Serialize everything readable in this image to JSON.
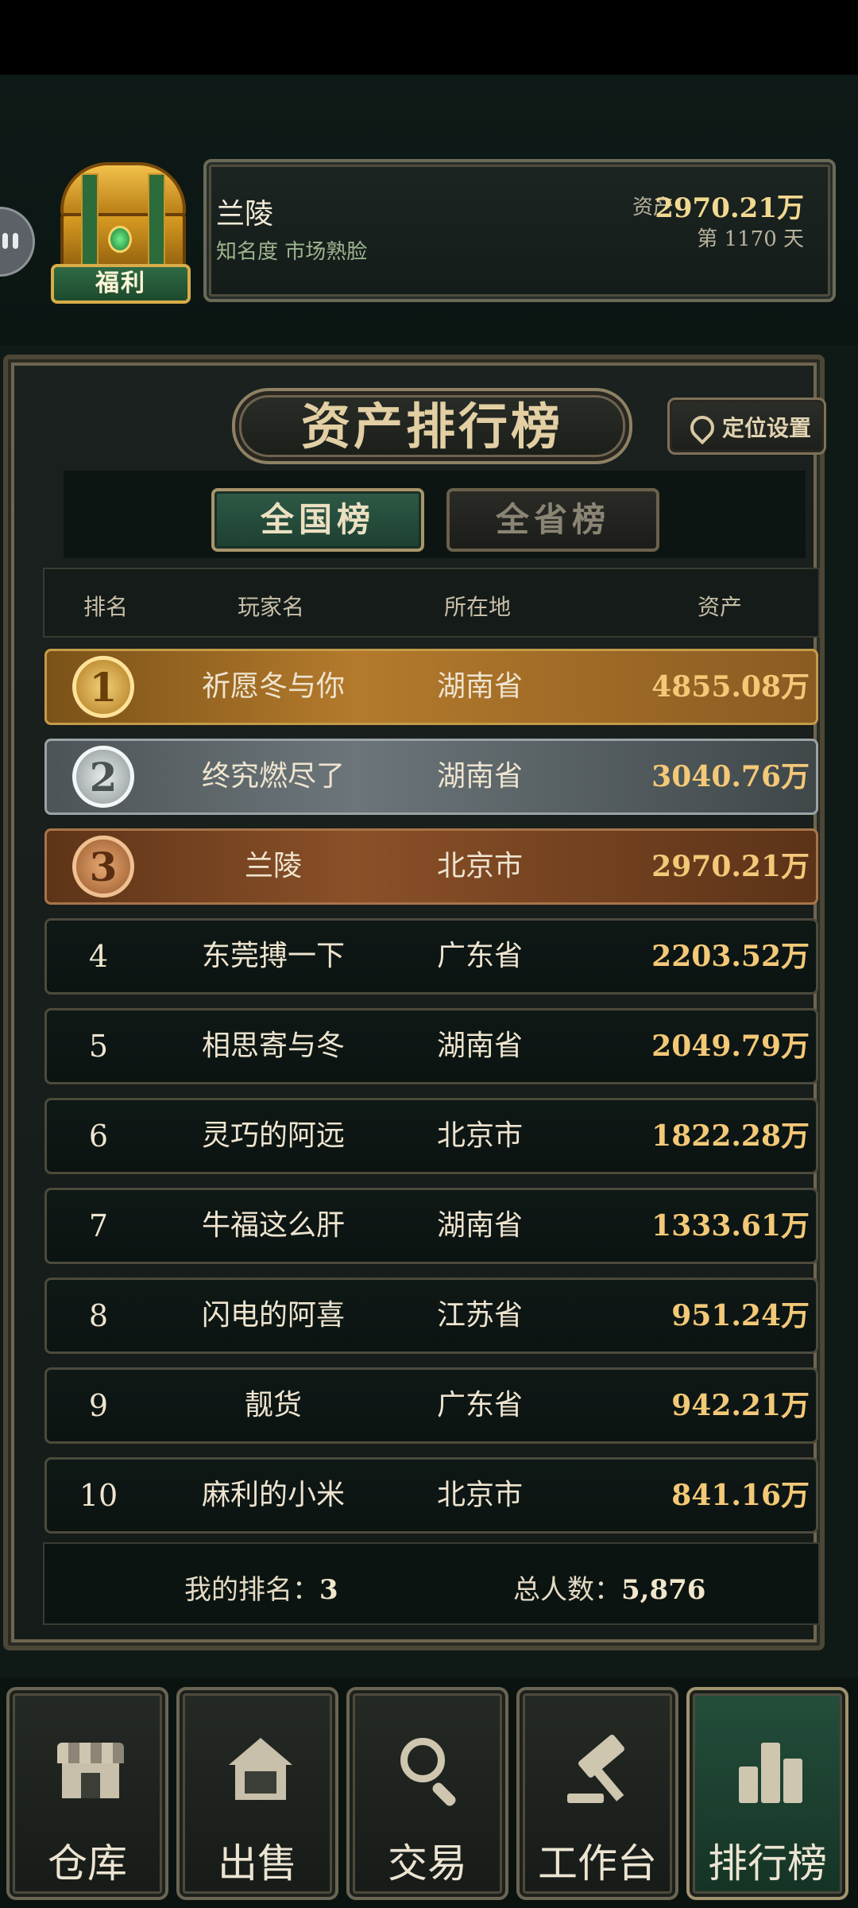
{
  "player": {
    "name": "兰陵",
    "fame": "知名度 市场熟脸",
    "asset_label": "资产",
    "asset_value": "2970.21万",
    "day": "第 1170 天"
  },
  "welfare_label": "福利",
  "panel": {
    "title": "资产排行榜",
    "location_button": "定位设置",
    "tabs": [
      {
        "label": "全国榜",
        "active": true
      },
      {
        "label": "全省榜",
        "active": false
      }
    ],
    "columns": [
      "排名",
      "玩家名",
      "所在地",
      "资产"
    ]
  },
  "rankings": [
    {
      "rank": "1",
      "name": "祈愿冬与你",
      "location": "湖南省",
      "assets": "4855.08万"
    },
    {
      "rank": "2",
      "name": "终究燃尽了",
      "location": "湖南省",
      "assets": "3040.76万"
    },
    {
      "rank": "3",
      "name": "兰陵",
      "location": "北京市",
      "assets": "2970.21万"
    },
    {
      "rank": "4",
      "name": "东莞搏一下",
      "location": "广东省",
      "assets": "2203.52万"
    },
    {
      "rank": "5",
      "name": "相思寄与冬",
      "location": "湖南省",
      "assets": "2049.79万"
    },
    {
      "rank": "6",
      "name": "灵巧的阿远",
      "location": "北京市",
      "assets": "1822.28万"
    },
    {
      "rank": "7",
      "name": "牛福这么肝",
      "location": "湖南省",
      "assets": "1333.61万"
    },
    {
      "rank": "8",
      "name": "闪电的阿喜",
      "location": "江苏省",
      "assets": "951.24万"
    },
    {
      "rank": "9",
      "name": "靓货",
      "location": "广东省",
      "assets": "942.21万"
    },
    {
      "rank": "10",
      "name": "麻利的小米",
      "location": "北京市",
      "assets": "841.16万"
    }
  ],
  "footer": {
    "my_rank_label": "我的排名：",
    "my_rank_value": "3",
    "total_label": "总人数：",
    "total_value": "5,876"
  },
  "nav": [
    {
      "label": "仓库",
      "icon": "shop-icon",
      "active": false
    },
    {
      "label": "出售",
      "icon": "house-icon",
      "active": false
    },
    {
      "label": "交易",
      "icon": "search-icon",
      "active": false
    },
    {
      "label": "工作台",
      "icon": "gavel-icon",
      "active": false
    },
    {
      "label": "排行榜",
      "icon": "bar-chart-icon",
      "active": true
    }
  ]
}
